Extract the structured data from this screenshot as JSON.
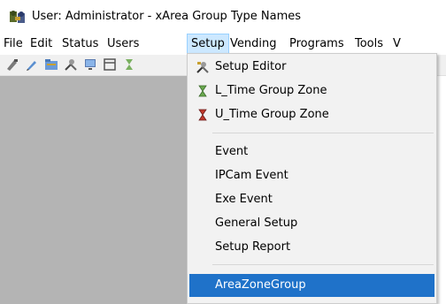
{
  "window": {
    "title": "User: Administrator - xArea Group Type Names",
    "app_icon": "key-people-icon"
  },
  "menubar": {
    "items": [
      {
        "label": "File"
      },
      {
        "label": "Edit"
      },
      {
        "label": "Status"
      },
      {
        "label": "Users"
      },
      {
        "label": "Setup"
      },
      {
        "label": "Vending"
      },
      {
        "label": "Programs"
      },
      {
        "label": "Tools"
      },
      {
        "label": "V"
      }
    ]
  },
  "toolbar": {
    "buttons": [
      "tool-icon",
      "pencil-icon",
      "folder-icon",
      "tools-icon",
      "monitor-icon",
      "window-icon",
      "hourglass-icon"
    ]
  },
  "setup_menu": {
    "items": [
      {
        "label": "Setup Editor",
        "icon": "tools-icon"
      },
      {
        "label": "L_Time Group Zone",
        "icon": "hourglass-green-icon"
      },
      {
        "label": "U_Time Group Zone",
        "icon": "hourglass-red-icon"
      },
      {
        "label": "Event"
      },
      {
        "label": "IPCam Event"
      },
      {
        "label": "Exe Event"
      },
      {
        "label": "General Setup"
      },
      {
        "label": "Setup Report"
      },
      {
        "label": "AreaZoneGroup"
      }
    ]
  },
  "colors": {
    "highlight": "#1f72c9",
    "menu_active": "#cce8ff",
    "client_area": "#b4b4b4"
  }
}
